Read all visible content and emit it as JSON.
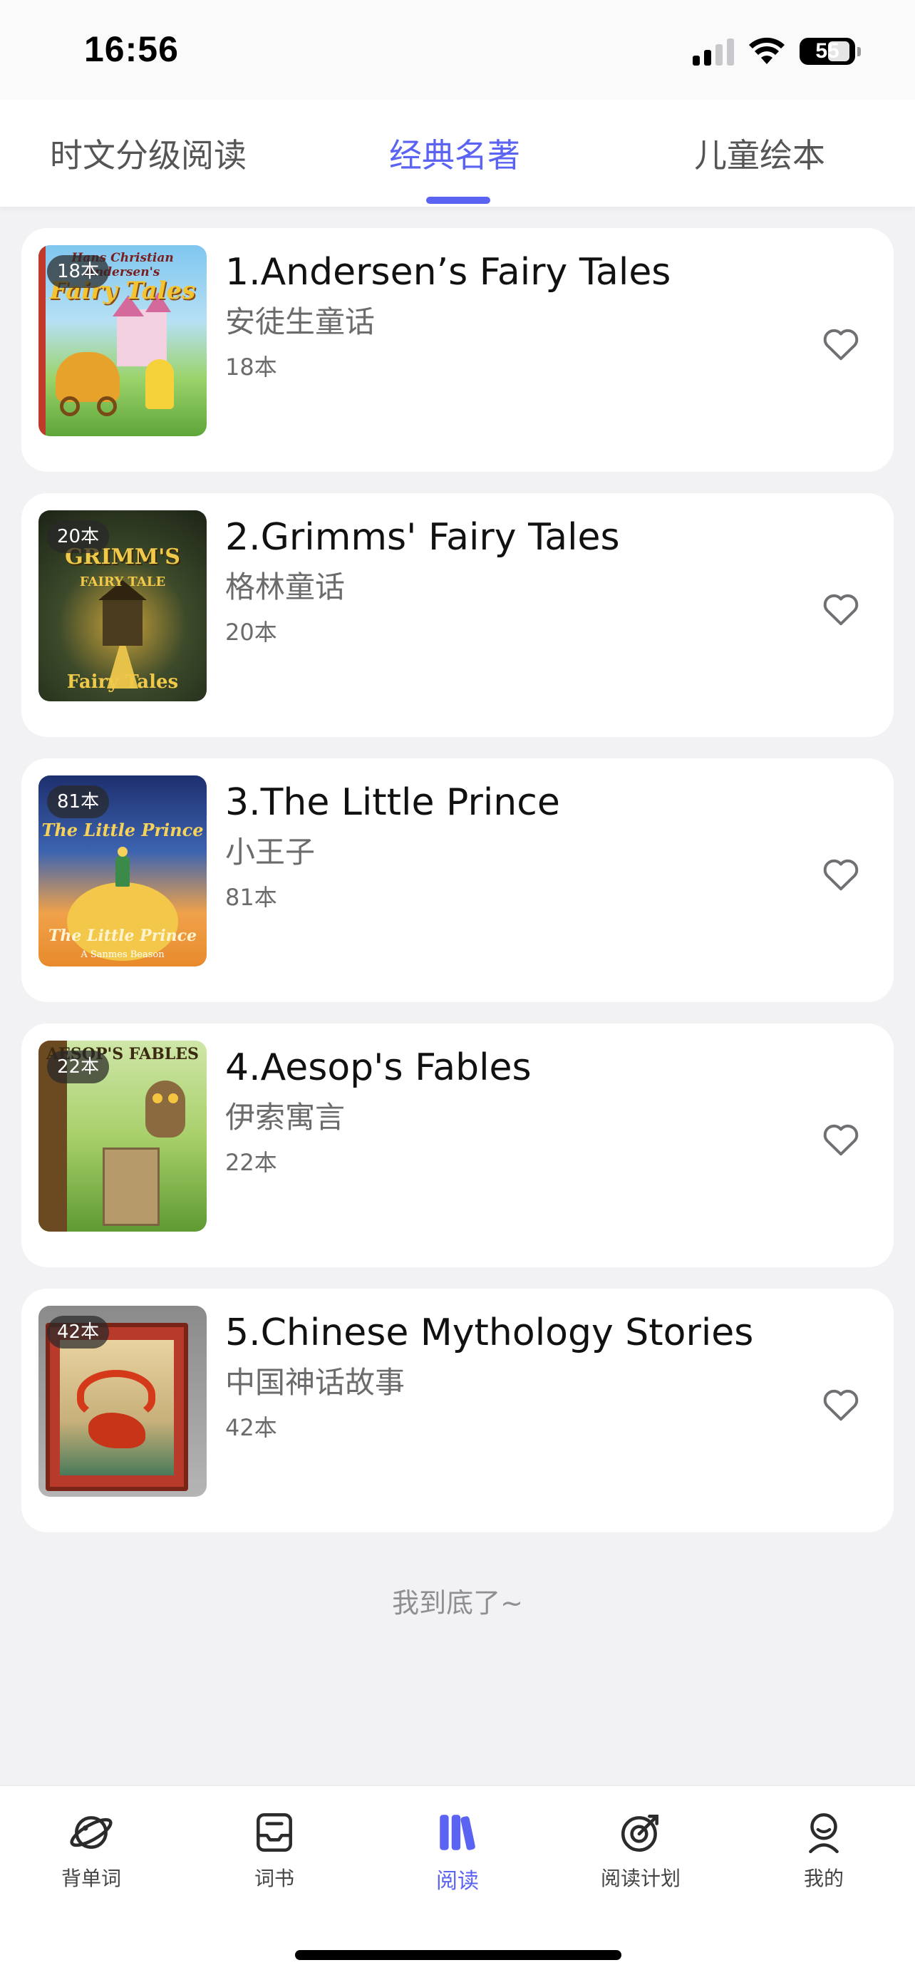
{
  "status_bar": {
    "time": "16:56",
    "battery": "55"
  },
  "tabs": [
    {
      "label": "时文分级阅读",
      "active": false
    },
    {
      "label": "经典名著",
      "active": true
    },
    {
      "label": "儿童绘本",
      "active": false
    }
  ],
  "books": [
    {
      "title": "1.Andersen’s Fairy Tales",
      "subtitle": "安徒生童话",
      "count": "18本",
      "badge": "18本",
      "cover_text": "Fairy Tales",
      "cover_top": "Hans Christian Andersen's"
    },
    {
      "title": "2.Grimms' Fairy Tales",
      "subtitle": "格林童话",
      "count": "20本",
      "badge": "20本",
      "cover_text": "GRIMM'S",
      "cover_top": "FAIRY TALE"
    },
    {
      "title": "3.The Little Prince",
      "subtitle": "小王子",
      "count": "81本",
      "badge": "81本",
      "cover_text": "The Little Prince",
      "cover_top": "The Little Prince"
    },
    {
      "title": "4.Aesop's Fables",
      "subtitle": "伊索寓言",
      "count": "22本",
      "badge": "22本",
      "cover_text": "AESOP'S FABLES",
      "cover_top": ""
    },
    {
      "title": "5.Chinese Mythology Stories",
      "subtitle": "中国神话故事",
      "count": "42本",
      "badge": "42本",
      "cover_text": "",
      "cover_top": ""
    }
  ],
  "end_text": "我到底了~",
  "bottom_nav": [
    {
      "label": "背单词",
      "icon": "planet-icon",
      "active": false
    },
    {
      "label": "词书",
      "icon": "book-tray-icon",
      "active": false
    },
    {
      "label": "阅读",
      "icon": "books-icon",
      "active": true
    },
    {
      "label": "阅读计划",
      "icon": "target-icon",
      "active": false
    },
    {
      "label": "我的",
      "icon": "profile-icon",
      "active": false
    }
  ],
  "colors": {
    "accent": "#5b63f2",
    "background": "#f2f2f4"
  }
}
